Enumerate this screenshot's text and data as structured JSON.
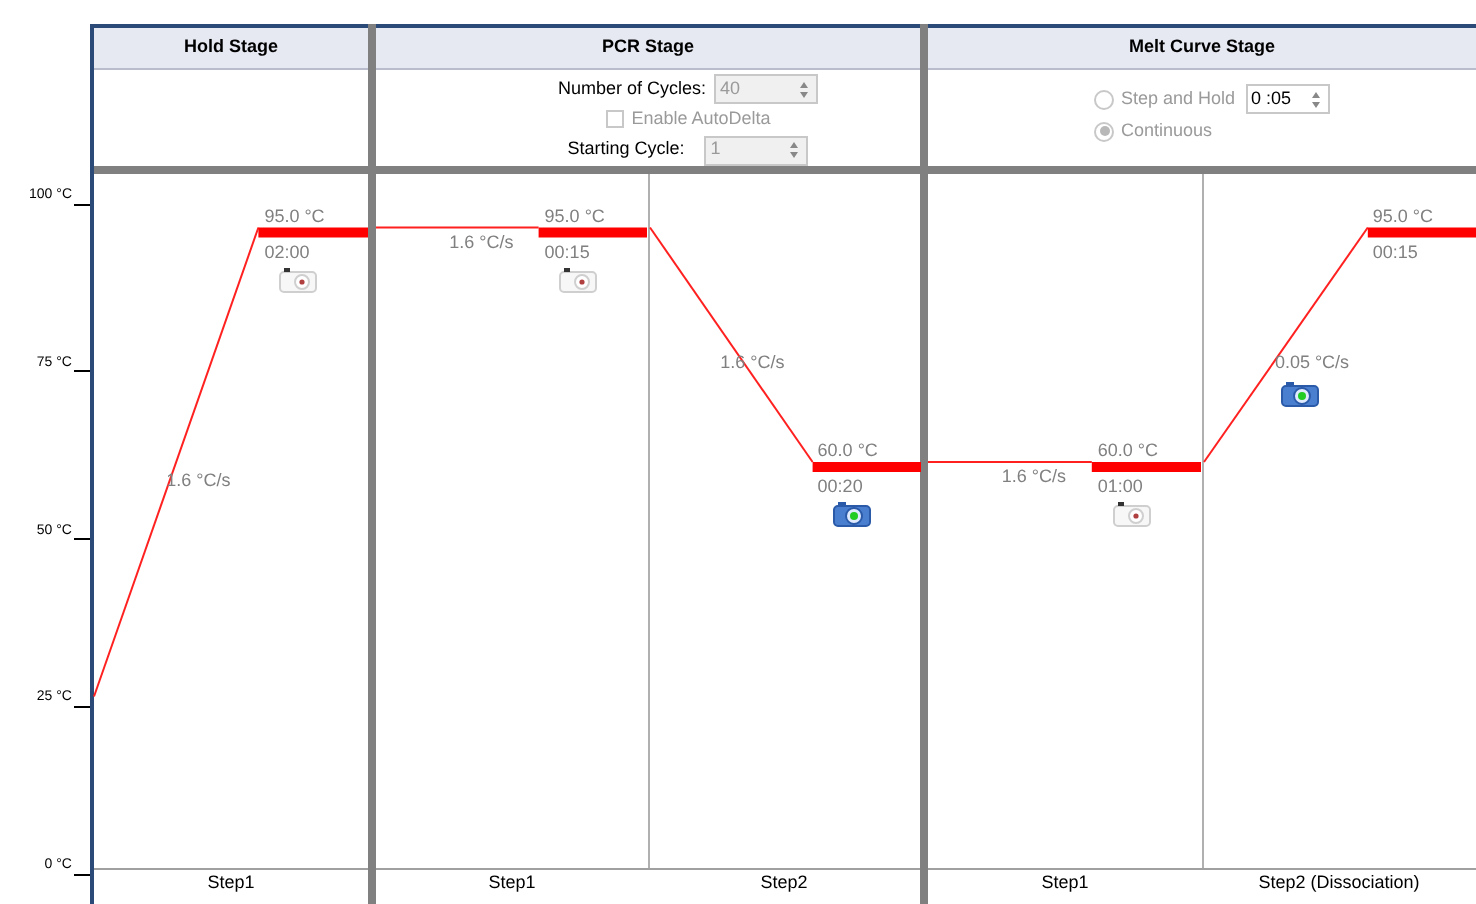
{
  "axis": {
    "ticks": [
      "100 °C",
      "75 °C",
      "50 °C",
      "25 °C",
      "0 °C"
    ]
  },
  "stages": [
    {
      "title": "Hold Stage",
      "settings": {
        "kind": "none"
      },
      "steps": [
        {
          "name": "Step1",
          "temperature": "95.0 °C",
          "time": "02:00",
          "ramp_rate": "1.6 °C/s",
          "collect": false,
          "kind": "hold"
        }
      ]
    },
    {
      "title": "PCR Stage",
      "settings": {
        "kind": "cycles",
        "disabled": true,
        "cycles_label": "Number of Cycles:",
        "cycles": "40",
        "autodelta": {
          "label": "Enable AutoDelta",
          "checked": false
        },
        "start_label": "Starting Cycle:",
        "start": "1"
      },
      "steps": [
        {
          "name": "Step1",
          "temperature": "95.0 °C",
          "time": "00:15",
          "ramp_rate": "1.6 °C/s",
          "collect": false,
          "kind": "hold"
        },
        {
          "name": "Step2",
          "temperature": "60.0 °C",
          "time": "00:20",
          "ramp_rate": "1.6 °C/s",
          "collect": true,
          "kind": "hold"
        }
      ]
    },
    {
      "title": "Melt Curve Stage",
      "settings": {
        "kind": "melt",
        "disabled": true,
        "options": [
          {
            "label": "Step and Hold",
            "selected": false
          },
          {
            "label": "Continuous",
            "selected": true
          }
        ],
        "step_time": "0 :05"
      },
      "steps": [
        {
          "name": "Step1",
          "temperature": "60.0 °C",
          "time": "01:00",
          "ramp_rate": "1.6 °C/s",
          "collect": false,
          "kind": "hold"
        },
        {
          "name": "Step2 (Dissociation)",
          "temperature": "95.0 °C",
          "time": "00:15",
          "ramp_rate": "0.05 °C/s",
          "collect": true,
          "kind": "ramp"
        }
      ]
    }
  ]
}
